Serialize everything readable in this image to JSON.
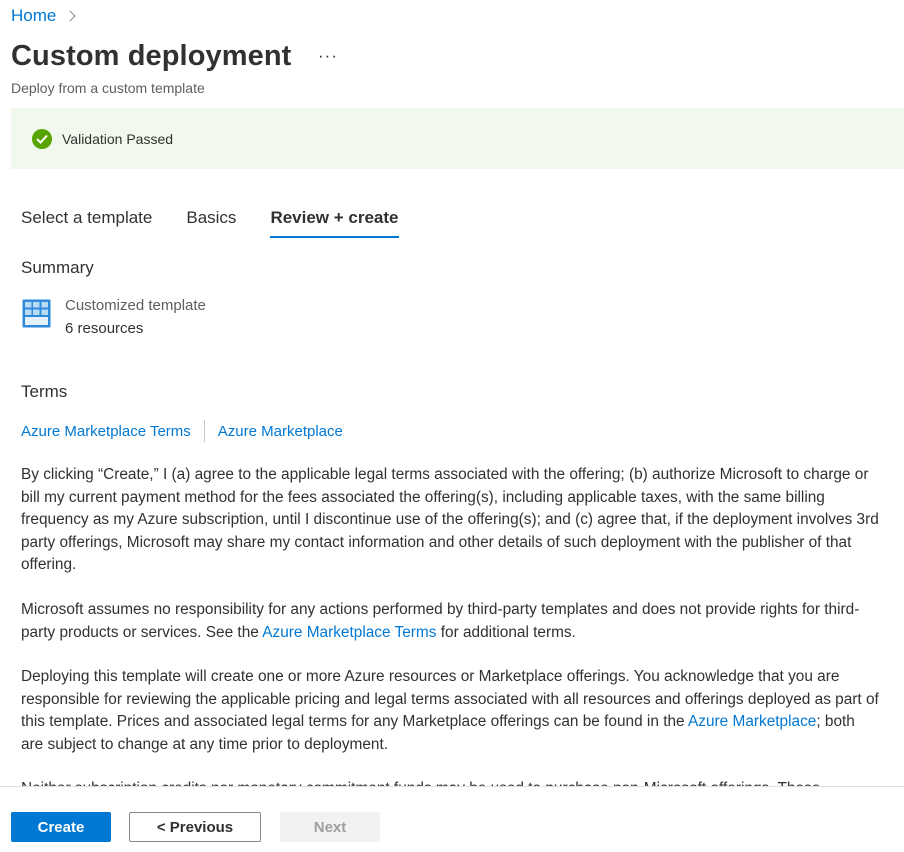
{
  "breadcrumb": {
    "home": "Home"
  },
  "header": {
    "title": "Custom deployment",
    "more": "···",
    "subtitle": "Deploy from a custom template"
  },
  "validation": {
    "text": "Validation Passed",
    "status_color": "#57a300"
  },
  "tabs": [
    {
      "label": "Select a template",
      "active": false
    },
    {
      "label": "Basics",
      "active": false
    },
    {
      "label": "Review + create",
      "active": true
    }
  ],
  "summary": {
    "heading": "Summary",
    "title": "Customized template",
    "count": "6 resources"
  },
  "terms": {
    "heading": "Terms",
    "links": [
      "Azure Marketplace Terms",
      "Azure Marketplace"
    ],
    "para1": "By clicking “Create,” I (a) agree to the applicable legal terms associated with the offering; (b) authorize Microsoft to charge or bill my current payment method for the fees associated the offering(s), including applicable taxes, with the same billing frequency as my Azure subscription, until I discontinue use of the offering(s); and (c) agree that, if the deployment involves 3rd party offerings, Microsoft may share my contact information and other details of such deployment with the publisher of that offering.",
    "para2_a": "Microsoft assumes no responsibility for any actions performed by third-party templates and does not provide rights for third-party products or services. See the ",
    "para2_link": "Azure Marketplace Terms",
    "para2_b": " for additional terms.",
    "para3_a": "Deploying this template will create one or more Azure resources or Marketplace offerings.  You acknowledge that you are responsible for reviewing the applicable pricing and legal terms associated with all resources and offerings deployed as part of this template.  Prices and associated legal terms for any Marketplace offerings can be found in the ",
    "para3_link": "Azure Marketplace",
    "para3_b": "; both are subject to change at any time prior to deployment.",
    "para4": "Neither subscription credits nor monetary commitment funds may be used to purchase non-Microsoft offerings. These"
  },
  "footer": {
    "create": "Create",
    "previous": "< Previous",
    "next": "Next"
  },
  "colors": {
    "accent": "#0078d4",
    "validation_bg": "#f1f9ec"
  }
}
